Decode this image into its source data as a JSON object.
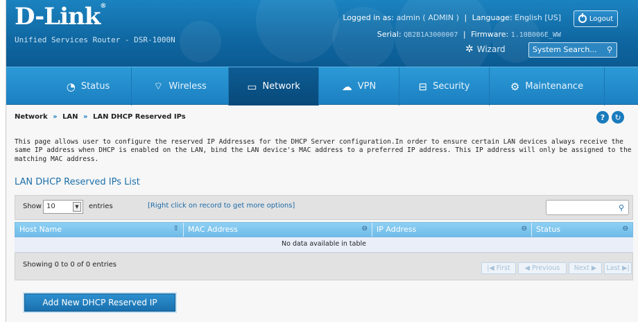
{
  "header": {
    "logo": "D-Link",
    "logo_mark": "®",
    "subtitle": "Unified Services Router - DSR-1000N",
    "logged_in_label": "Logged in as:",
    "logged_in_value": "admin ( ADMIN )",
    "language_label": "Language:",
    "language_value": "English [US]",
    "serial_label": "Serial:",
    "serial_value": "QB2B1A3000007",
    "firmware_label": "Firmware:",
    "firmware_value": "1.10B006E_WW",
    "logout_label": "Logout",
    "wizard_label": "Wizard",
    "search_placeholder": "System Search..."
  },
  "nav": {
    "items": [
      {
        "label": "Status",
        "icon": "gauge-icon"
      },
      {
        "label": "Wireless",
        "icon": "wifi-icon"
      },
      {
        "label": "Network",
        "icon": "monitor-icon",
        "active": true
      },
      {
        "label": "VPN",
        "icon": "vpn-cloud-icon"
      },
      {
        "label": "Security",
        "icon": "lock-icon"
      },
      {
        "label": "Maintenance",
        "icon": "gears-icon"
      }
    ]
  },
  "breadcrumb": {
    "items": [
      "Network",
      "LAN",
      "LAN DHCP Reserved IPs"
    ],
    "separator": "»"
  },
  "description": "This page allows user to configure the reserved IP Addresses for the DHCP Server configuration.In order to ensure certain LAN devices always receive the same IP address when DHCP is enabled on the LAN, bind the LAN device's MAC address to a preferred IP address. This IP address will only be assigned to the matching MAC address.",
  "section_title": "LAN DHCP Reserved IPs List",
  "table": {
    "show_label": "Show",
    "entries_value": "10",
    "entries_label": "entries",
    "hint": "[Right click on record to get more options]",
    "columns": [
      "Host Name",
      "MAC Address",
      "IP Address",
      "Status"
    ],
    "empty_message": "No data available in table",
    "info": "Showing 0 to 0 of 0 entries",
    "pager": {
      "first": "First",
      "previous": "Previous",
      "next": "Next",
      "last": "Last"
    }
  },
  "add_button": "Add New DHCP Reserved IP",
  "colors": {
    "header_blue": "#0f67a1",
    "nav_blue": "#1c80c2",
    "accent": "#1a7bbd"
  }
}
